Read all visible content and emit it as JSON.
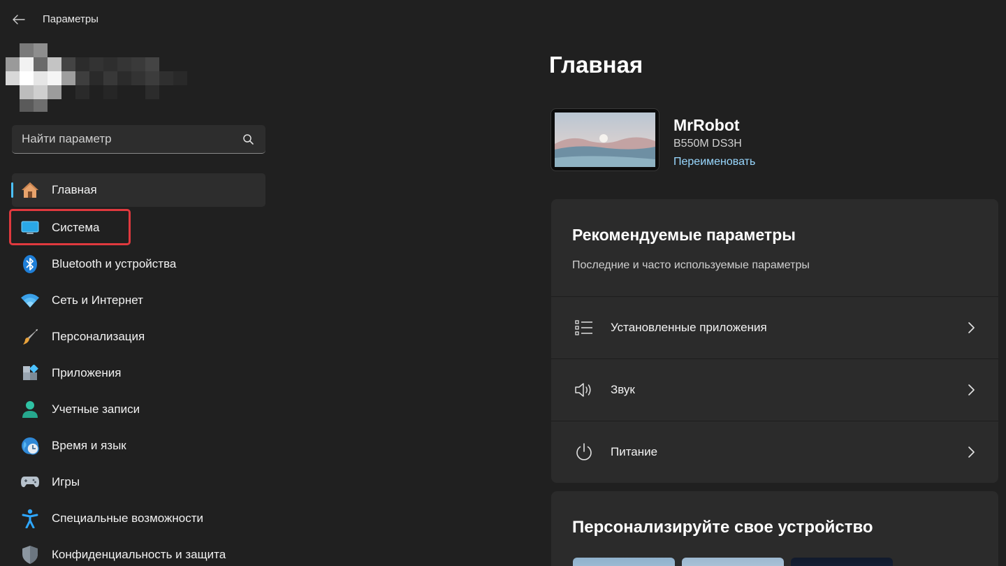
{
  "app": {
    "title": "Параметры"
  },
  "search": {
    "placeholder": "Найти параметр"
  },
  "nav": {
    "items": [
      {
        "label": "Главная",
        "icon": "home-icon",
        "active": true
      },
      {
        "label": "Система",
        "icon": "system-display-icon"
      },
      {
        "label": "Bluetooth и устройства",
        "icon": "bluetooth-icon"
      },
      {
        "label": "Сеть и Интернет",
        "icon": "wifi-icon"
      },
      {
        "label": "Персонализация",
        "icon": "brush-icon"
      },
      {
        "label": "Приложения",
        "icon": "apps-icon"
      },
      {
        "label": "Учетные записи",
        "icon": "account-icon"
      },
      {
        "label": "Время и язык",
        "icon": "time-language-icon"
      },
      {
        "label": "Игры",
        "icon": "gamepad-icon"
      },
      {
        "label": "Специальные возможности",
        "icon": "accessibility-icon"
      },
      {
        "label": "Конфиденциальность и защита",
        "icon": "shield-icon"
      }
    ]
  },
  "main": {
    "title": "Главная",
    "device": {
      "name": "MrRobot",
      "model": "B550M DS3H",
      "rename": "Переименовать"
    },
    "recommended": {
      "title": "Рекомендуемые параметры",
      "subtitle": "Последние и часто используемые параметры",
      "items": [
        {
          "label": "Установленные приложения",
          "icon": "list-icon"
        },
        {
          "label": "Звук",
          "icon": "speaker-icon"
        },
        {
          "label": "Питание",
          "icon": "power-icon"
        }
      ]
    },
    "personalize": {
      "title": "Персонализируйте свое устройство"
    }
  },
  "colors": {
    "accent": "#4cc2ff",
    "link": "#99d8ff",
    "highlight": "#e0393e",
    "background": "#202020",
    "card": "#2b2b2b"
  }
}
